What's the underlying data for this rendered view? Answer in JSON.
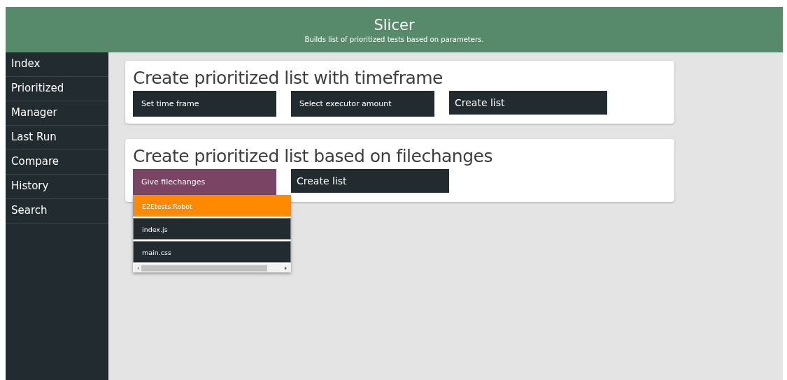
{
  "header": {
    "title": "Slicer",
    "subtitle": "Builds list of prioritized tests based on parameters."
  },
  "sidebar": {
    "items": [
      {
        "label": "Index"
      },
      {
        "label": "Prioritized"
      },
      {
        "label": "Manager"
      },
      {
        "label": "Last Run"
      },
      {
        "label": "Compare"
      },
      {
        "label": "History"
      },
      {
        "label": "Search"
      }
    ]
  },
  "cards": [
    {
      "title": "Create prioritized list with timeframe",
      "controls": [
        {
          "kind": "select",
          "label": "Set time frame",
          "open": false
        },
        {
          "kind": "select",
          "label": "Select executor amount",
          "open": false
        },
        {
          "kind": "button",
          "label": "Create list"
        }
      ]
    },
    {
      "title": "Create prioritized list based on filechanges",
      "controls": [
        {
          "kind": "select",
          "label": "Give filechanges",
          "open": true,
          "options": [
            {
              "label": "E2Etests.Robot",
              "selected": true
            },
            {
              "label": "index.js",
              "selected": false
            },
            {
              "label": "main.css",
              "selected": false
            }
          ]
        },
        {
          "kind": "button",
          "label": "Create list"
        }
      ]
    }
  ]
}
